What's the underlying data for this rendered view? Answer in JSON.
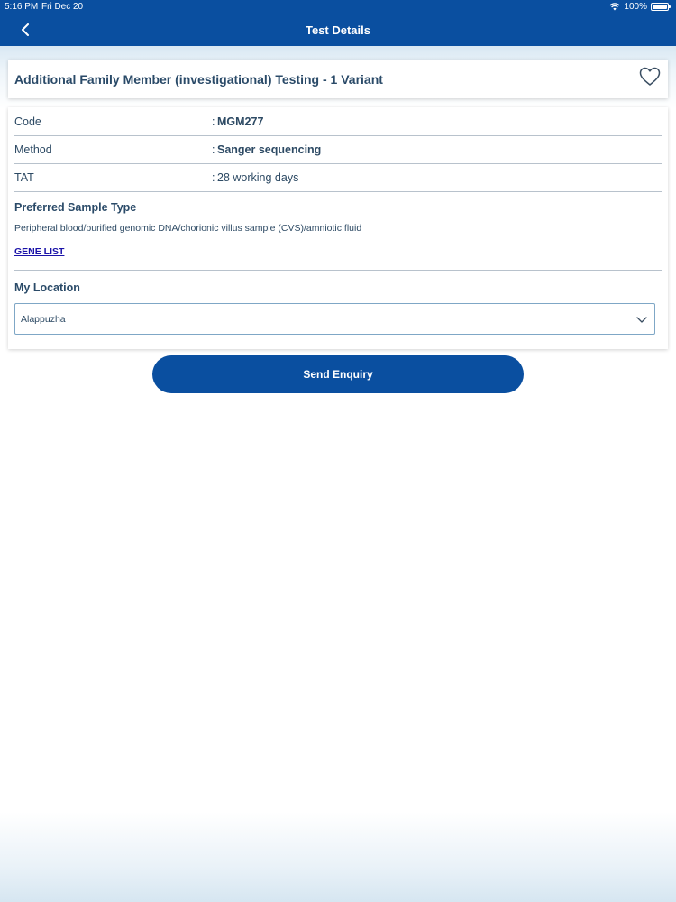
{
  "status_bar": {
    "time": "5:16 PM",
    "date": "Fri Dec 20",
    "battery": "100%"
  },
  "header": {
    "title": "Test Details"
  },
  "test": {
    "title": "Additional Family Member (investigational) Testing - 1 Variant",
    "favorited": false
  },
  "details": [
    {
      "label": "Code",
      "colon": ":",
      "value": "MGM277"
    },
    {
      "label": "Method",
      "colon": ":",
      "value": "Sanger sequencing"
    },
    {
      "label": "TAT",
      "colon": ":",
      "value": "28 working days"
    }
  ],
  "sample": {
    "heading": "Preferred Sample Type",
    "text": "Peripheral blood/purified genomic DNA/chorionic villus sample (CVS)/amniotic fluid",
    "gene_list_label": "GENE LIST"
  },
  "location": {
    "heading": "My Location",
    "selected": "Alappuzha"
  },
  "actions": {
    "send_enquiry_label": "Send Enquiry"
  },
  "colors": {
    "primary": "#0a4fa0",
    "text": "#2c4a66",
    "link": "#1a12a8"
  },
  "icons": {
    "back": "chevron-left-icon",
    "favorite": "heart-outline-icon",
    "dropdown": "chevron-down-icon",
    "wifi": "wifi-icon",
    "battery": "battery-icon"
  }
}
